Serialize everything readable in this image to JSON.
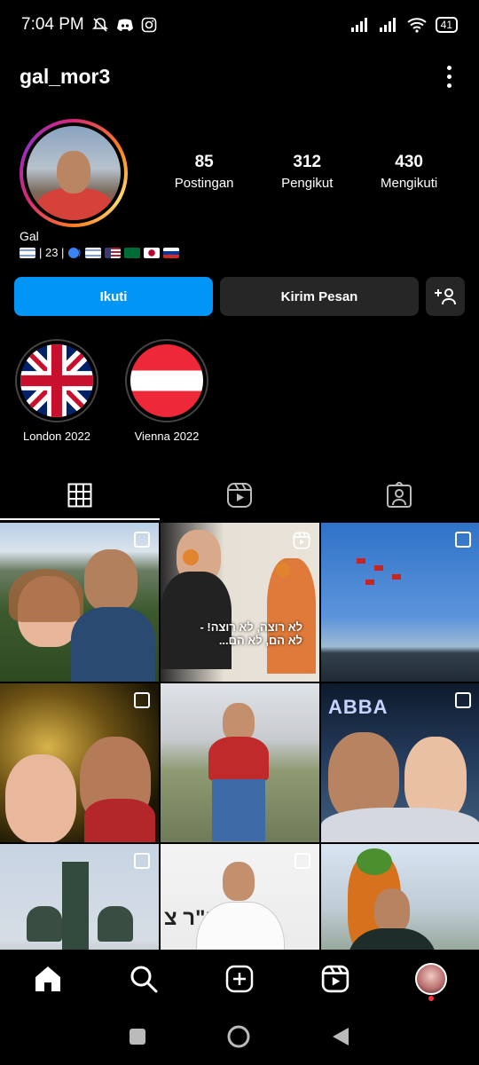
{
  "status_bar": {
    "time": "7:04 PM",
    "battery": "41"
  },
  "profile": {
    "username": "gal_mor3",
    "name": "Gal",
    "bio_age": "| 23 |",
    "stats": [
      {
        "num": "85",
        "label": "Postingan"
      },
      {
        "num": "312",
        "label": "Pengikut"
      },
      {
        "num": "430",
        "label": "Mengikuti"
      }
    ]
  },
  "buttons": {
    "follow": "Ikuti",
    "message": "Kirim Pesan",
    "add_user": "+"
  },
  "highlights": [
    {
      "label": "London 2022"
    },
    {
      "label": "Vienna 2022"
    }
  ],
  "posts": [
    {
      "type": "multi"
    },
    {
      "type": "reel",
      "caption": "לא רוצה, לא רוצה! - לא הם, לא הם..."
    },
    {
      "type": "multi"
    },
    {
      "type": "multi"
    },
    {
      "type": "photo"
    },
    {
      "type": "multi",
      "overlay": "ABBA"
    },
    {
      "type": "multi"
    },
    {
      "type": "multi",
      "sign": "בית דו\"ר צ"
    },
    {
      "type": "photo"
    }
  ],
  "colors": {
    "accent": "#0095f6",
    "secondary_btn": "#262626",
    "notification": "#ff3040"
  }
}
